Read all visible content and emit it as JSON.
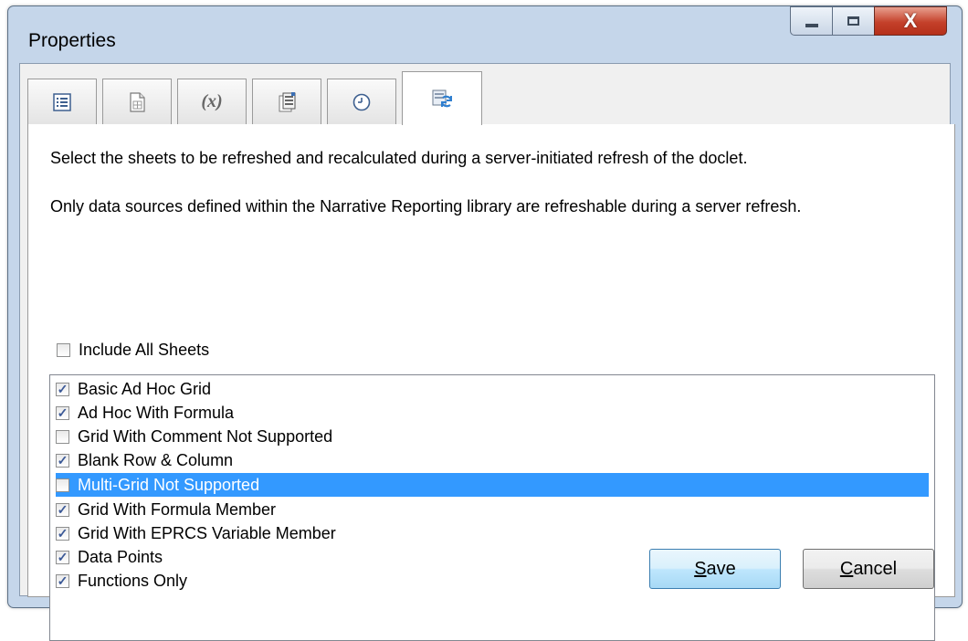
{
  "window": {
    "title": "Properties"
  },
  "caption": {
    "minimize_icon": "minimize-icon",
    "maximize_icon": "maximize-icon",
    "close_icon": "close-icon",
    "close_glyph": "X"
  },
  "tabs": [
    {
      "icon": "list-icon",
      "label": ""
    },
    {
      "icon": "document-grid-icon",
      "label": ""
    },
    {
      "icon": "variable-icon",
      "label": "(x)"
    },
    {
      "icon": "report-icon",
      "label": ""
    },
    {
      "icon": "clock-icon",
      "label": ""
    },
    {
      "icon": "refresh-icon",
      "label": "",
      "active": true
    }
  ],
  "panel": {
    "description_1": "Select the sheets to be refreshed and recalculated during a server-initiated refresh of the doclet.",
    "description_2": "Only data sources defined within the Narrative Reporting library are refreshable during a server refresh.",
    "include_all_label": "Include All Sheets",
    "include_all_checked": false,
    "sheets": [
      {
        "label": "Basic Ad Hoc Grid",
        "checked": true
      },
      {
        "label": "Ad Hoc With Formula",
        "checked": true
      },
      {
        "label": "Grid With Comment Not Supported",
        "checked": false
      },
      {
        "label": "Blank Row & Column",
        "checked": true
      },
      {
        "label": "Multi-Grid Not Supported",
        "checked": false,
        "selected": true
      },
      {
        "label": "Grid With Formula Member",
        "checked": true
      },
      {
        "label": "Grid With EPRCS Variable Member",
        "checked": true
      },
      {
        "label": "Data Points",
        "checked": true
      },
      {
        "label": "Functions Only",
        "checked": true
      }
    ]
  },
  "buttons": {
    "save_mnemonic": "S",
    "save_rest": "ave",
    "cancel_mnemonic": "C",
    "cancel_rest": "ancel"
  },
  "colors": {
    "selection": "#3399ff",
    "check": "#3b5997",
    "title_bar": "#c5d6ea"
  }
}
